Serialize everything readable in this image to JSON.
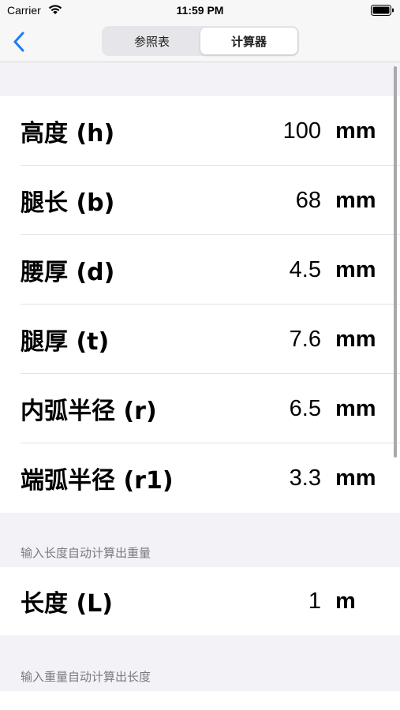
{
  "status_bar": {
    "carrier": "Carrier",
    "time": "11:59 PM"
  },
  "nav": {
    "back_icon": "chevron-left-icon",
    "tabs": [
      {
        "label": "参照表",
        "selected": false
      },
      {
        "label": "计算器",
        "selected": true
      }
    ],
    "accent": "#1a7cf5"
  },
  "dimensions": [
    {
      "label": "高度 (h)",
      "value": "100",
      "unit": "mm"
    },
    {
      "label": "腿长 (b)",
      "value": "68",
      "unit": "mm"
    },
    {
      "label": "腰厚 (d)",
      "value": "4.5",
      "unit": "mm"
    },
    {
      "label": "腿厚 (t)",
      "value": "7.6",
      "unit": "mm"
    },
    {
      "label": "内弧半径 (r)",
      "value": "6.5",
      "unit": "mm"
    },
    {
      "label": "端弧半径 (r1)",
      "value": "3.3",
      "unit": "mm"
    }
  ],
  "length_section": {
    "caption": "输入长度自动计算出重量",
    "row": {
      "label": "长度 (L)",
      "value": "1",
      "unit": "m"
    }
  },
  "weight_section": {
    "caption": "输入重量自动计算出长度"
  }
}
